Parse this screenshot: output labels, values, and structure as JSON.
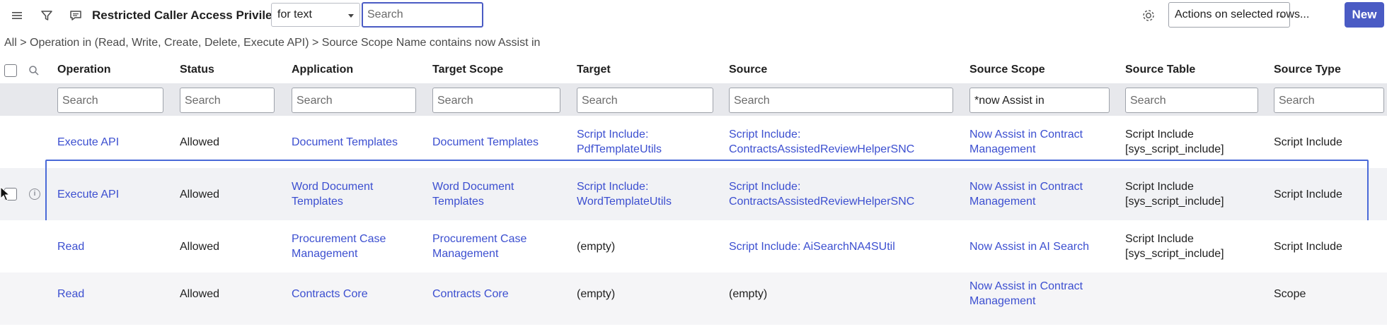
{
  "toolbar": {
    "title": "Restricted Caller Access Privileges",
    "search_field_select": "for text",
    "search_placeholder": "Search",
    "actions_select": "Actions on selected rows...",
    "new_label": "New",
    "icons": [
      "hamburger-menu-icon",
      "filter-icon",
      "comment-icon",
      "gear-icon"
    ]
  },
  "breadcrumb": "All > Operation in (Read, Write, Create, Delete, Execute API) > Source Scope Name contains now Assist in",
  "columns": [
    "Operation",
    "Status",
    "Application",
    "Target Scope",
    "Target",
    "Source",
    "Source Scope",
    "Source Table",
    "Source Type"
  ],
  "column_search": [
    "Search",
    "Search",
    "Search",
    "Search",
    "Search",
    "Search",
    "*now Assist in",
    "Search",
    "Search"
  ],
  "rows": [
    {
      "operation": "Execute API",
      "status": "Allowed",
      "application": [
        "Document Templates"
      ],
      "target_scope": [
        "Document Templates"
      ],
      "target": [
        "Script Include:",
        "PdfTemplateUtils"
      ],
      "source": [
        "Script Include:",
        "ContractsAssistedReviewHelperSNC"
      ],
      "source_scope": [
        "Now Assist in Contract",
        "Management"
      ],
      "source_table": [
        "Script Include",
        "[sys_script_include]"
      ],
      "source_type": "Script Include"
    },
    {
      "operation": "Execute API",
      "status": "Allowed",
      "application": [
        "Word Document",
        "Templates"
      ],
      "target_scope": [
        "Word Document",
        "Templates"
      ],
      "target": [
        "Script Include:",
        "WordTemplateUtils"
      ],
      "source": [
        "Script Include:",
        "ContractsAssistedReviewHelperSNC"
      ],
      "source_scope": [
        "Now Assist in Contract",
        "Management"
      ],
      "source_table": [
        "Script Include",
        "[sys_script_include]"
      ],
      "source_type": "Script Include"
    },
    {
      "operation": "Read",
      "status": "Allowed",
      "application": [
        "Procurement Case",
        "Management"
      ],
      "target_scope": [
        "Procurement Case",
        "Management"
      ],
      "target": [
        "(empty)"
      ],
      "source": [
        "Script Include: AiSearchNA4SUtil"
      ],
      "source_scope": [
        "Now Assist in AI Search"
      ],
      "source_table": [
        "Script Include",
        "[sys_script_include]"
      ],
      "source_type": "Script Include"
    },
    {
      "operation": "Read",
      "status": "Allowed",
      "application": [
        "Contracts Core"
      ],
      "target_scope": [
        "Contracts Core"
      ],
      "target": [
        "(empty)"
      ],
      "source": [
        "(empty)"
      ],
      "source_scope": [
        "Now Assist in Contract",
        "Management"
      ],
      "source_table": [],
      "source_type": "Scope"
    }
  ],
  "colors": {
    "link": "#3c4fd0",
    "accent": "#4a5bc4",
    "selected_row_outline": "#4a6ad8",
    "search_row_bg": "#e7e8ec",
    "alt_row_bg": "#f5f5f7"
  }
}
